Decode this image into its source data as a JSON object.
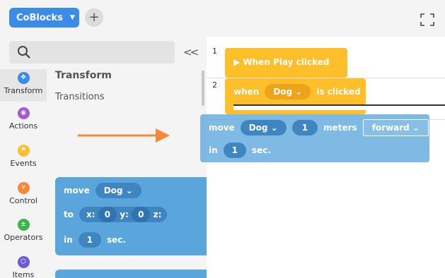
{
  "topbar": {
    "project_label": "CoBlocks",
    "chevron_label": "⌄",
    "add_label": "+"
  },
  "sidebar": {
    "collapse_label": "<<",
    "categories": [
      {
        "label": "Transform",
        "color": "#3b8beb",
        "icon": "transform-icon"
      },
      {
        "label": "Actions",
        "color": "#a35ad6",
        "icon": "actions-icon"
      },
      {
        "label": "Events",
        "color": "#ffbf2b",
        "icon": "events-icon"
      },
      {
        "label": "Control",
        "color": "#f5883a",
        "icon": "control-icon"
      },
      {
        "label": "Operators",
        "color": "#3ab54a",
        "icon": "operators-icon"
      },
      {
        "label": "Items",
        "color": "#6a5ad6",
        "icon": "items-icon"
      }
    ],
    "section_title": "Transform",
    "section_sub": "Transitions"
  },
  "palette": {
    "move_label": "move",
    "target": "Dog",
    "to_label": "to",
    "x_label": "x:",
    "x_value": "0",
    "y_label": "y:",
    "y_value": "0",
    "z_label": "z:",
    "in_label": "in",
    "duration": "1",
    "sec_label": "sec."
  },
  "workspace": {
    "line_numbers": [
      "1",
      "2"
    ],
    "play_block": "▶ When Play clicked",
    "when_label": "when",
    "when_target": "Dog",
    "is_clicked_label": "is clicked",
    "drag": {
      "move_label": "move",
      "target": "Dog",
      "distance": "1",
      "meters_label": "meters",
      "direction": "forward",
      "in_label": "in",
      "duration": "1",
      "sec_label": "sec."
    }
  },
  "colors": {
    "accent": "#3b8beb",
    "event_block": "#ffbf2b",
    "motion_block": "#5aa6dc",
    "arrow": "#f5883a"
  }
}
